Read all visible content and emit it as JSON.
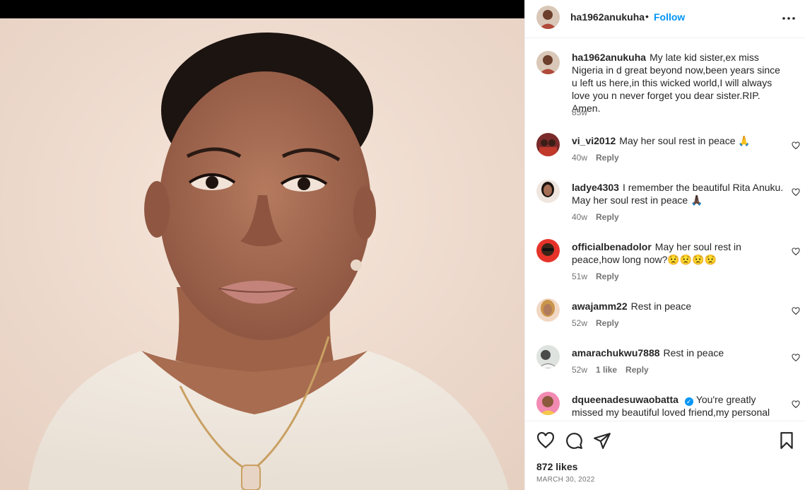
{
  "post": {
    "author": "ha1962anukuha",
    "follow_label": "Follow",
    "separator": "•",
    "more_icon": "more-horizontal-icon",
    "caption": "My late kid sister,ex miss Nigeria in d great beyond now,been years since u left us here,in this wicked world,I will always love you n never forget you dear sister.RIP. Amen.",
    "caption_age": "85w"
  },
  "comments": [
    {
      "user": "vi_vi2012",
      "text": "May her soul rest in peace 🙏",
      "age": "40w",
      "likes": "",
      "reply": "Reply"
    },
    {
      "user": "ladye4303",
      "text": "I remember the beautiful Rita Anuku. May her soul rest in peace 🙏🏿",
      "age": "40w",
      "likes": "",
      "reply": "Reply"
    },
    {
      "user": "officialbenadolor",
      "text": "May her soul rest in peace,how long now?😟😟😟😟",
      "age": "51w",
      "likes": "",
      "reply": "Reply"
    },
    {
      "user": "awajamm22",
      "text": "Rest in peace",
      "age": "52w",
      "likes": "",
      "reply": "Reply"
    },
    {
      "user": "amarachukwu7888",
      "text": "Rest in peace",
      "age": "52w",
      "likes": "1 like",
      "reply": "Reply"
    },
    {
      "user": "dqueenadesuwaobatta",
      "text": "You're greatly missed my beautiful loved friend,my personal person,",
      "age": "",
      "likes": "",
      "reply": "",
      "verified": true
    }
  ],
  "footer": {
    "likes": "872 likes",
    "date": "MARCH 30, 2022"
  },
  "icons": [
    "heart-icon",
    "comment-icon",
    "share-icon",
    "bookmark-icon"
  ]
}
